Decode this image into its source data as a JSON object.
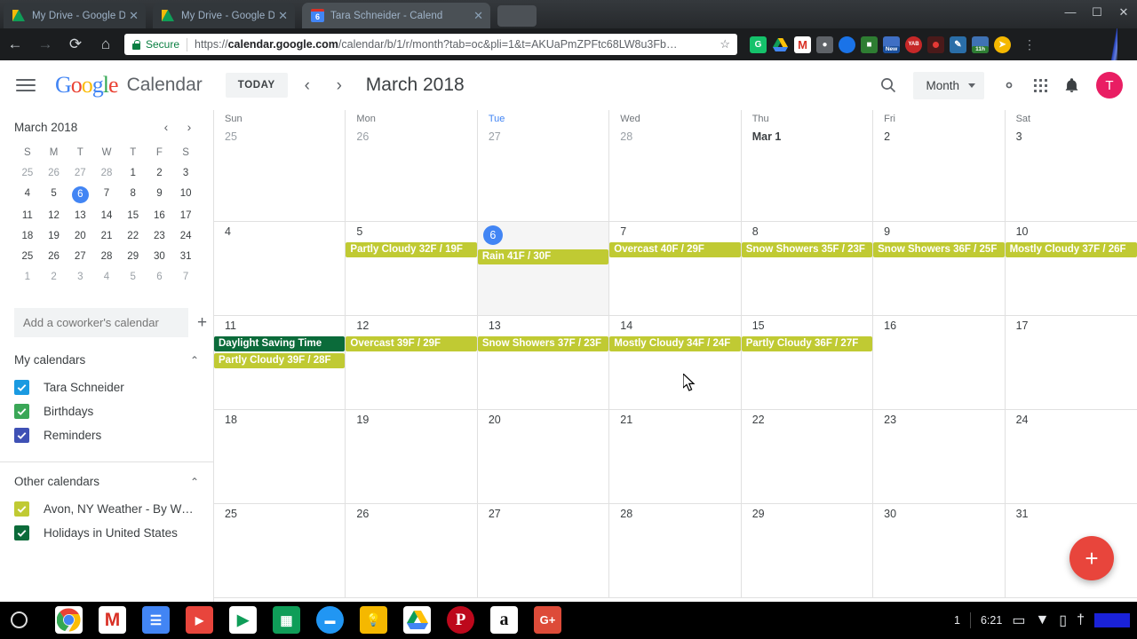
{
  "browser": {
    "tabs": [
      {
        "title": "My Drive - Google Drive",
        "favicon": "drive-icon",
        "active": false
      },
      {
        "title": "My Drive - Google Drive",
        "favicon": "drive-icon",
        "active": false
      },
      {
        "title": "Tara Schneider - Calend",
        "favicon": "calendar-icon",
        "active": true
      }
    ],
    "window_controls": {
      "minimize": "—",
      "maximize": "☐",
      "close": "✕"
    },
    "nav": {
      "back": "←",
      "forward": "→",
      "reload": "⟳",
      "home": "⌂"
    },
    "omnibox": {
      "security_label": "Secure",
      "scheme": "https://",
      "host": "calendar.google.com",
      "path": "/calendar/b/1/r/month?tab=oc&pli=1&t=AKUaPmZPFtc68LW8u3Fb…",
      "bookmark_star": "☆"
    },
    "extensions": [
      {
        "name": "grammarly-extension-icon",
        "glyph": "G",
        "bg": "#15c26b"
      },
      {
        "name": "google-drive-extension-icon",
        "glyph": "",
        "bg": "transparent"
      },
      {
        "name": "gmail-extension-icon",
        "glyph": "M",
        "bg": "#d93025"
      },
      {
        "name": "google-keep-extension-icon",
        "glyph": "○",
        "bg": "#5f6368"
      },
      {
        "name": "blue-circle-extension-icon",
        "glyph": "●",
        "bg": "#1a73e8"
      },
      {
        "name": "green-notes-extension-icon",
        "glyph": "■",
        "bg": "#2e7d32"
      },
      {
        "name": "new-badge-extension-icon",
        "glyph": "≡",
        "bg": "#3f6fc4",
        "badge": "New",
        "badge_bg": "#1a4f9c"
      },
      {
        "name": "yab-extension-icon",
        "glyph": "YAB",
        "bg": "#c62828"
      },
      {
        "name": "screen-recorder-extension-icon",
        "glyph": "●",
        "bg": "#4a1a1a"
      },
      {
        "name": "pen-extension-icon",
        "glyph": "✐",
        "bg": "#2a6ea8"
      },
      {
        "name": "timer-extension-icon",
        "glyph": "☰",
        "bg": "#3f72b4",
        "badge": "11h",
        "badge_bg": "#2e7d32"
      },
      {
        "name": "compass-extension-icon",
        "glyph": "➤",
        "bg": "#f5b800"
      }
    ],
    "menu_icon": "⋮"
  },
  "appbar": {
    "menu_label": "menu",
    "brand": {
      "g1": "G",
      "o1": "o",
      "o2": "o",
      "g2": "g",
      "l": "l",
      "e": "e"
    },
    "product": "Calendar",
    "today_label": "TODAY",
    "prev_label": "‹",
    "next_label": "›",
    "period": "March 2018",
    "search_label": "search",
    "view_selected": "Month",
    "settings_label": "settings",
    "apps_label": "Google apps",
    "notifications_label": "notifications",
    "avatar_initial": "T"
  },
  "sidebar": {
    "mini_calendar": {
      "title": "March 2018",
      "prev": "‹",
      "next": "›",
      "dow": [
        "S",
        "M",
        "T",
        "W",
        "T",
        "F",
        "S"
      ],
      "weeks": [
        [
          {
            "d": "25",
            "t": "other"
          },
          {
            "d": "26",
            "t": "other"
          },
          {
            "d": "27",
            "t": "other"
          },
          {
            "d": "28",
            "t": "other"
          },
          {
            "d": "1",
            "t": "cur"
          },
          {
            "d": "2",
            "t": "cur"
          },
          {
            "d": "3",
            "t": "cur"
          }
        ],
        [
          {
            "d": "4",
            "t": "cur"
          },
          {
            "d": "5",
            "t": "cur"
          },
          {
            "d": "6",
            "t": "sel"
          },
          {
            "d": "7",
            "t": "cur"
          },
          {
            "d": "8",
            "t": "cur"
          },
          {
            "d": "9",
            "t": "cur"
          },
          {
            "d": "10",
            "t": "cur"
          }
        ],
        [
          {
            "d": "11",
            "t": "cur"
          },
          {
            "d": "12",
            "t": "cur"
          },
          {
            "d": "13",
            "t": "cur"
          },
          {
            "d": "14",
            "t": "cur"
          },
          {
            "d": "15",
            "t": "cur"
          },
          {
            "d": "16",
            "t": "cur"
          },
          {
            "d": "17",
            "t": "cur"
          }
        ],
        [
          {
            "d": "18",
            "t": "cur"
          },
          {
            "d": "19",
            "t": "cur"
          },
          {
            "d": "20",
            "t": "cur"
          },
          {
            "d": "21",
            "t": "cur"
          },
          {
            "d": "22",
            "t": "cur"
          },
          {
            "d": "23",
            "t": "cur"
          },
          {
            "d": "24",
            "t": "cur"
          }
        ],
        [
          {
            "d": "25",
            "t": "cur"
          },
          {
            "d": "26",
            "t": "cur"
          },
          {
            "d": "27",
            "t": "cur"
          },
          {
            "d": "28",
            "t": "cur"
          },
          {
            "d": "29",
            "t": "cur"
          },
          {
            "d": "30",
            "t": "cur"
          },
          {
            "d": "31",
            "t": "cur"
          }
        ],
        [
          {
            "d": "1",
            "t": "other"
          },
          {
            "d": "2",
            "t": "other"
          },
          {
            "d": "3",
            "t": "other"
          },
          {
            "d": "4",
            "t": "other"
          },
          {
            "d": "5",
            "t": "other"
          },
          {
            "d": "6",
            "t": "other"
          },
          {
            "d": "7",
            "t": "other"
          }
        ]
      ]
    },
    "add_calendar": {
      "placeholder": "Add a coworker's calendar",
      "plus": "+"
    },
    "my_calendars": {
      "title": "My calendars",
      "collapse": "⌃",
      "items": [
        {
          "label": "Tara Schneider",
          "color": "#1a9ae1",
          "checked": true
        },
        {
          "label": "Birthdays",
          "color": "#3aa757",
          "checked": true
        },
        {
          "label": "Reminders",
          "color": "#3f51b5",
          "checked": true
        }
      ]
    },
    "other_calendars": {
      "title": "Other calendars",
      "collapse": "⌃",
      "items": [
        {
          "label": "Avon, NY Weather - By We…",
          "color": "#c0ca33",
          "checked": true
        },
        {
          "label": "Holidays in United States",
          "color": "#0b6b3a",
          "checked": true
        }
      ]
    }
  },
  "calendar_grid": {
    "day_headers": [
      {
        "label": "Sun",
        "highlight": false
      },
      {
        "label": "Mon",
        "highlight": false
      },
      {
        "label": "Tue",
        "highlight": true
      },
      {
        "label": "Wed",
        "highlight": false
      },
      {
        "label": "Thu",
        "highlight": false
      },
      {
        "label": "Fri",
        "highlight": false
      },
      {
        "label": "Sat",
        "highlight": false
      }
    ],
    "weeks": [
      {
        "days": [
          {
            "num": "25",
            "style": "other",
            "today": false,
            "events": []
          },
          {
            "num": "26",
            "style": "other",
            "today": false,
            "events": []
          },
          {
            "num": "27",
            "style": "other",
            "today": false,
            "events": []
          },
          {
            "num": "28",
            "style": "other",
            "today": false,
            "events": []
          },
          {
            "num": "Mar 1",
            "style": "bold",
            "today": false,
            "events": []
          },
          {
            "num": "2",
            "style": "normal",
            "today": false,
            "events": []
          },
          {
            "num": "3",
            "style": "normal",
            "today": false,
            "events": []
          }
        ]
      },
      {
        "days": [
          {
            "num": "4",
            "style": "normal",
            "today": false,
            "events": []
          },
          {
            "num": "5",
            "style": "normal",
            "today": false,
            "events": [
              {
                "title": "Partly Cloudy 32F / 19F",
                "type": "weather"
              }
            ]
          },
          {
            "num": "6",
            "style": "circle",
            "today": true,
            "events": [
              {
                "title": "Rain 41F / 30F",
                "type": "weather"
              }
            ]
          },
          {
            "num": "7",
            "style": "normal",
            "today": false,
            "events": [
              {
                "title": "Overcast 40F / 29F",
                "type": "weather"
              }
            ]
          },
          {
            "num": "8",
            "style": "normal",
            "today": false,
            "events": [
              {
                "title": "Snow Showers 35F / 23F",
                "type": "weather"
              }
            ]
          },
          {
            "num": "9",
            "style": "normal",
            "today": false,
            "events": [
              {
                "title": "Snow Showers 36F / 25F",
                "type": "weather"
              }
            ]
          },
          {
            "num": "10",
            "style": "normal",
            "today": false,
            "events": [
              {
                "title": "Mostly Cloudy 37F / 26F",
                "type": "weather"
              }
            ]
          }
        ]
      },
      {
        "days": [
          {
            "num": "11",
            "style": "normal",
            "today": false,
            "events": [
              {
                "title": "Daylight Saving Time",
                "type": "holiday"
              },
              {
                "title": "Partly Cloudy 39F / 28F",
                "type": "weather"
              }
            ]
          },
          {
            "num": "12",
            "style": "normal",
            "today": false,
            "events": [
              {
                "title": "Overcast 39F / 29F",
                "type": "weather"
              }
            ]
          },
          {
            "num": "13",
            "style": "normal",
            "today": false,
            "events": [
              {
                "title": "Snow Showers 37F / 23F",
                "type": "weather"
              }
            ]
          },
          {
            "num": "14",
            "style": "normal",
            "today": false,
            "events": [
              {
                "title": "Mostly Cloudy 34F / 24F",
                "type": "weather"
              }
            ]
          },
          {
            "num": "15",
            "style": "normal",
            "today": false,
            "events": [
              {
                "title": "Partly Cloudy 36F / 27F",
                "type": "weather"
              }
            ]
          },
          {
            "num": "16",
            "style": "normal",
            "today": false,
            "events": []
          },
          {
            "num": "17",
            "style": "normal",
            "today": false,
            "events": []
          }
        ]
      },
      {
        "days": [
          {
            "num": "18",
            "style": "normal",
            "today": false,
            "events": []
          },
          {
            "num": "19",
            "style": "normal",
            "today": false,
            "events": []
          },
          {
            "num": "20",
            "style": "normal",
            "today": false,
            "events": []
          },
          {
            "num": "21",
            "style": "normal",
            "today": false,
            "events": []
          },
          {
            "num": "22",
            "style": "normal",
            "today": false,
            "events": []
          },
          {
            "num": "23",
            "style": "normal",
            "today": false,
            "events": []
          },
          {
            "num": "24",
            "style": "normal",
            "today": false,
            "events": []
          }
        ]
      },
      {
        "days": [
          {
            "num": "25",
            "style": "normal",
            "today": false,
            "events": []
          },
          {
            "num": "26",
            "style": "normal",
            "today": false,
            "events": []
          },
          {
            "num": "27",
            "style": "normal",
            "today": false,
            "events": []
          },
          {
            "num": "28",
            "style": "normal",
            "today": false,
            "events": []
          },
          {
            "num": "29",
            "style": "normal",
            "today": false,
            "events": []
          },
          {
            "num": "30",
            "style": "normal",
            "today": false,
            "events": []
          },
          {
            "num": "31",
            "style": "normal",
            "today": false,
            "events": []
          }
        ]
      }
    ],
    "create_button_label": "+"
  },
  "colors": {
    "weather_chip": "#c0ca33",
    "holiday_chip": "#0b6b3a",
    "today_blue": "#4285f4",
    "fab_red": "#e8453c",
    "avatar_pink": "#e91e63"
  },
  "shelf": {
    "launcher_label": "launcher",
    "apps": [
      {
        "name": "chrome-app-icon",
        "glyph": "",
        "bg": "#ffffff"
      },
      {
        "name": "gmail-app-icon",
        "glyph": "M",
        "bg": "#ffffff",
        "fg": "#d93025"
      },
      {
        "name": "google-docs-app-icon",
        "glyph": "≡",
        "bg": "#4285f4"
      },
      {
        "name": "youtube-app-icon",
        "glyph": "▶",
        "bg": "#e8453c"
      },
      {
        "name": "play-store-app-icon",
        "glyph": "▶",
        "bg": "#ffffff"
      },
      {
        "name": "google-sheets-app-icon",
        "glyph": "▦",
        "bg": "#0f9d58"
      },
      {
        "name": "files-app-icon",
        "glyph": "▬",
        "bg": "#2196f3"
      },
      {
        "name": "google-keep-app-icon",
        "glyph": "☁",
        "bg": "#f5b800"
      },
      {
        "name": "google-drive-app-icon",
        "glyph": "",
        "bg": "#ffffff"
      },
      {
        "name": "pinterest-app-icon",
        "glyph": "P",
        "bg": "#bd081c"
      },
      {
        "name": "amazon-app-icon",
        "glyph": "a",
        "bg": "#ffffff",
        "fg": "#111111"
      },
      {
        "name": "google-plus-app-icon",
        "glyph": "G+",
        "bg": "#dd4b39"
      }
    ],
    "tray": {
      "count": "1",
      "time": "6:21",
      "cast_icon": "▭",
      "wifi_icon": "▼",
      "battery_icon": "▯",
      "user_icon": "†"
    }
  }
}
